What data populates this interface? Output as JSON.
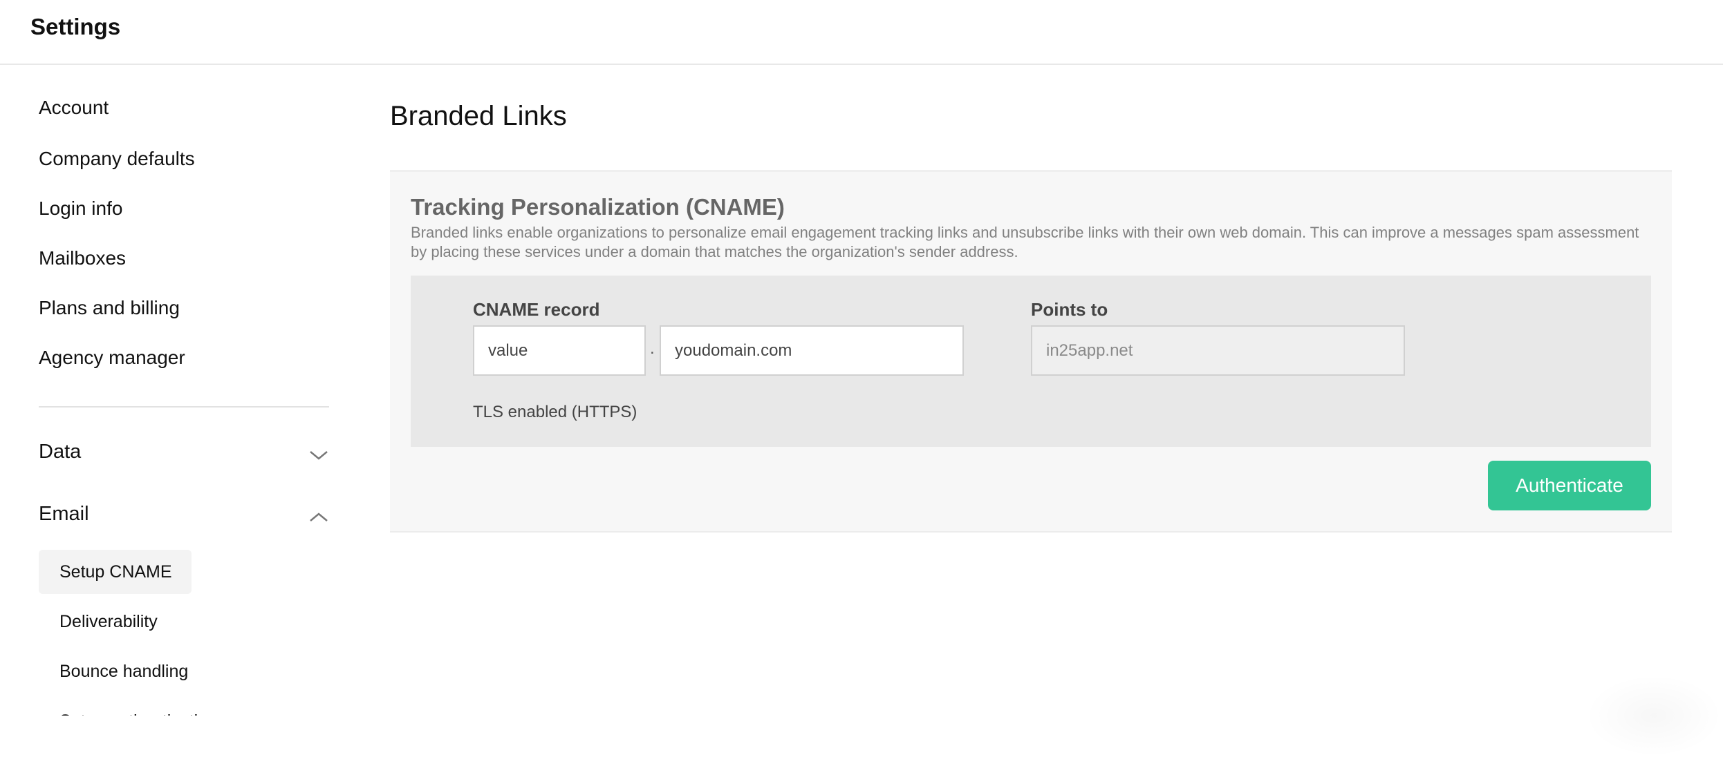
{
  "header": {
    "title": "Settings"
  },
  "sidebar": {
    "items": [
      {
        "label": "Account"
      },
      {
        "label": "Company defaults"
      },
      {
        "label": "Login info"
      },
      {
        "label": "Mailboxes"
      },
      {
        "label": "Plans and billing"
      },
      {
        "label": "Agency manager"
      }
    ],
    "sections": [
      {
        "label": "Data",
        "expanded": false,
        "icon": "chevron-down-icon"
      },
      {
        "label": "Email",
        "expanded": true,
        "icon": "chevron-up-icon",
        "children": [
          {
            "label": "Setup CNAME",
            "active": true
          },
          {
            "label": "Deliverability",
            "active": false
          },
          {
            "label": "Bounce handling",
            "active": false
          },
          {
            "label": "Setup authentication",
            "active": false
          }
        ]
      }
    ]
  },
  "main": {
    "title": "Branded Links",
    "card": {
      "title": "Tracking Personalization (CNAME)",
      "description": "Branded links enable organizations to personalize email engagement tracking links and unsubscribe links with their own web domain. This can improve a messages spam assessment by placing these services under a domain that matches the organization's sender address.",
      "cname_label": "CNAME record",
      "subdomain_value": "value",
      "separator": ".",
      "domain_value": "youdomain.com",
      "tls_text": "TLS enabled (HTTPS)",
      "points_to_label": "Points to",
      "points_to_value": "in25app.net",
      "authenticate_label": "Authenticate"
    }
  },
  "colors": {
    "accent": "#33c594",
    "card_bg": "#f7f7f7",
    "inner_bg": "#e8e8e8",
    "active_item_bg": "#f3f3f3"
  }
}
